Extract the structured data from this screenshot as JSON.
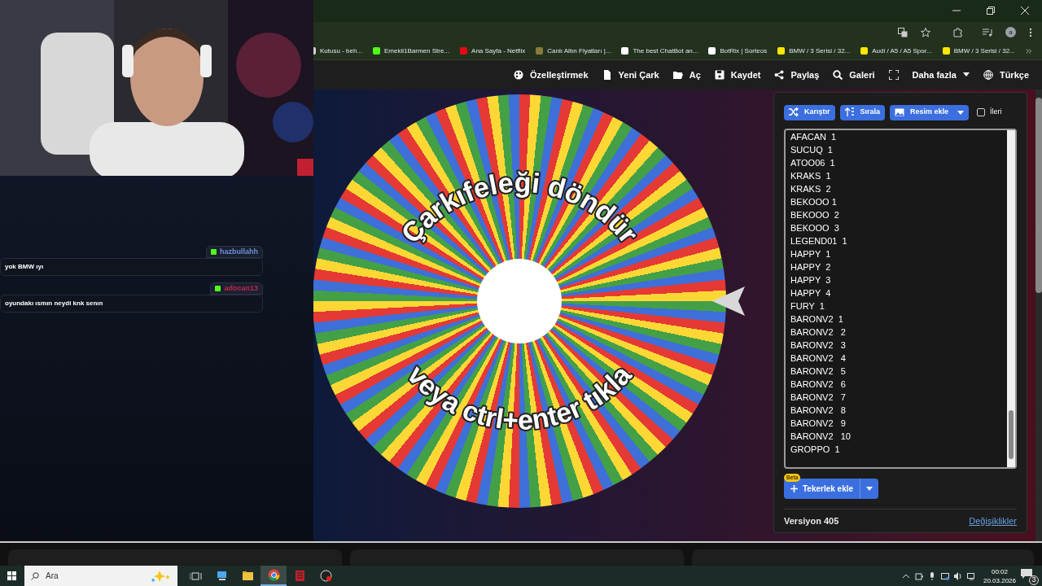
{
  "chat": {
    "messages": [
      {
        "user": "hazbullahh",
        "color": "#6b8fd8",
        "text": "yok BMW ıyı"
      },
      {
        "user": "adocan13",
        "color": "#c0284a",
        "text": "oyundakı ısmın neydi knk senın"
      }
    ]
  },
  "browser": {
    "profile_initial": "a",
    "bookmarks": [
      {
        "label": "Kutusu - beh...",
        "color": "#d0d0d0"
      },
      {
        "label": "Emekli1Barmen Stre...",
        "color": "#53fc18"
      },
      {
        "label": "Ana Sayfa - Netflix",
        "color": "#e50914"
      },
      {
        "label": "Canlı Altın Fiyatları |...",
        "color": "#8a7a3a"
      },
      {
        "label": "The best ChatBot an...",
        "color": "#ffffff"
      },
      {
        "label": "BotRix | Sorteos",
        "color": "#ffffff"
      },
      {
        "label": "BMW / 3 Serisi / 32...",
        "color": "#ffe600"
      },
      {
        "label": "Audi / A5 / A5 Spor...",
        "color": "#ffe600"
      },
      {
        "label": "BMW / 3 Serisi / 32...",
        "color": "#ffe600"
      }
    ]
  },
  "toolbar": {
    "items": [
      "Özelleştirmek",
      "Yeni Çark",
      "Aç",
      "Kaydet",
      "Paylaş",
      "Galeri",
      "Daha fazla",
      "Türkçe"
    ]
  },
  "wheel": {
    "top_text": "Çarkıfeleği döndür",
    "bottom_text": "veya ctrl+enter tıkla"
  },
  "panel": {
    "buttons": [
      "Karıştır",
      "Sırala",
      "Resim ekle"
    ],
    "advanced": {
      "label": "İleri",
      "checked": false
    },
    "entries": [
      "AFACAN  1",
      "SUCUQ  1",
      "ATOO06  1",
      "KRAKS  1",
      "KRAKS  2",
      "BEKOOO 1",
      "BEKOOO  2",
      "BEKOOO  3",
      "LEGEND01  1",
      "HAPPY  1",
      "HAPPY  2",
      "HAPPY  3",
      "HAPPY  4",
      "FURY  1",
      "BARONV2  1",
      "BARONV2   2",
      "BARONV2   3",
      "BARONV2   4",
      "BARONV2   5",
      "BARONV2   6",
      "BARONV2   7",
      "BARONV2   8",
      "BARONV2   9",
      "BARONV2   10",
      "GROPPO  1"
    ],
    "add_button": "Tekerlek ekle",
    "badge": "Beta",
    "version": "Versiyon 405",
    "changes_link": "Değişiklikler"
  },
  "taskbar": {
    "search_placeholder": "Ara",
    "time": "00:02",
    "date": "20.03.2026",
    "notifications": "3"
  }
}
